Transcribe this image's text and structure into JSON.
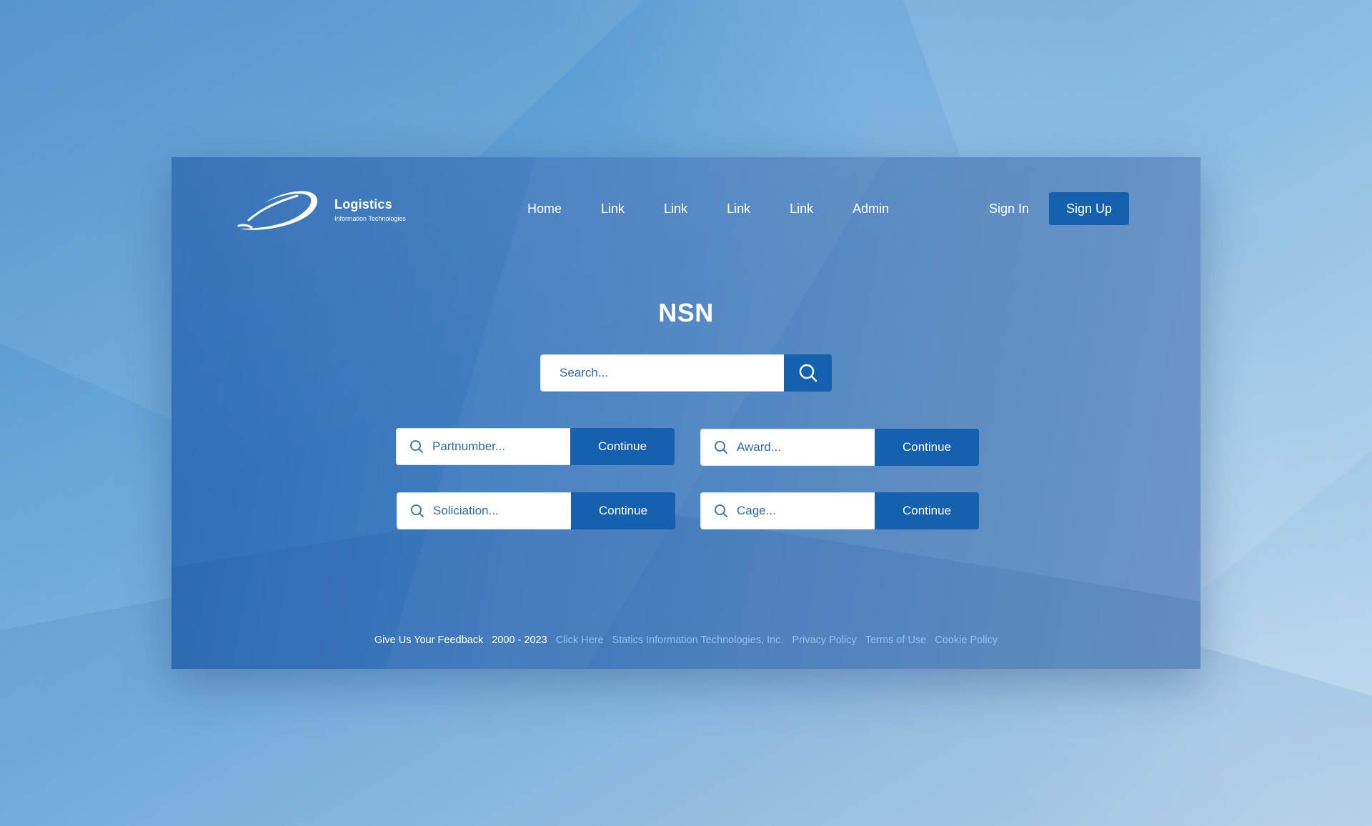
{
  "brand": {
    "name": "Logistics",
    "tagline": "Information Technologies"
  },
  "nav": {
    "items": [
      {
        "label": "Home"
      },
      {
        "label": "Link"
      },
      {
        "label": "Link"
      },
      {
        "label": "Link"
      },
      {
        "label": "Link"
      },
      {
        "label": "Admin"
      }
    ]
  },
  "auth": {
    "sign_in": "Sign In",
    "sign_up": "Sign Up"
  },
  "hero": {
    "title": "NSN",
    "search_placeholder": "Search..."
  },
  "fields": [
    {
      "placeholder": "Partnumber...",
      "button": "Continue"
    },
    {
      "placeholder": "Award...",
      "button": "Continue"
    },
    {
      "placeholder": "Soliciation...",
      "button": "Continue"
    },
    {
      "placeholder": "Cage...",
      "button": "Continue"
    }
  ],
  "footer": {
    "feedback": "Give Us Your Feedback",
    "years": "2000 - 2023",
    "click_here": "Click Here",
    "company": "Statics Information Technologies, Inc.",
    "privacy": "Privacy Policy",
    "terms": "Terms of Use",
    "cookie": "Cookie Policy"
  },
  "colors": {
    "accent": "#1660b0",
    "link": "#8fc2f2",
    "card": "#3f7cbf"
  },
  "icons": {
    "search": "search-icon",
    "logo": "logo-swoosh-icon"
  }
}
